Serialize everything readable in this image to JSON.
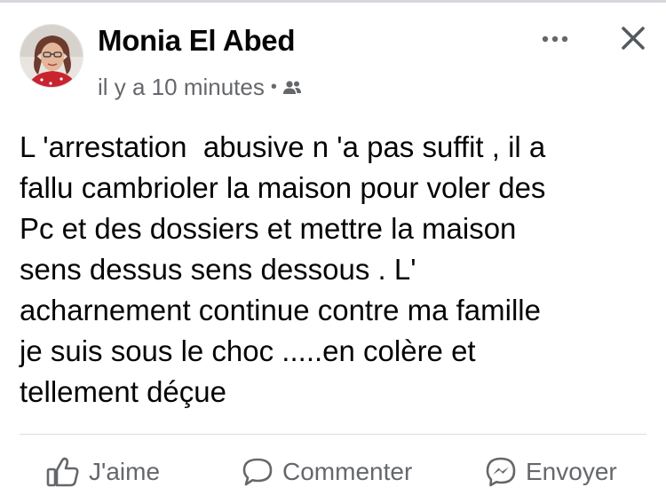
{
  "post": {
    "author": "Monia El Abed",
    "timestamp": "il y a 10 minutes",
    "separator": "•",
    "audience_icon": "friends-icon",
    "text": "L 'arrestation  abusive n 'a pas suffit , il a\nfallu cambrioler la maison pour voler des\nPc et des dossiers et mettre la maison\nsens dessus sens dessous . L'\nacharnement continue contre ma famille\nje suis sous le choc .....en colère et\ntellement déçue"
  },
  "header_actions": {
    "more_icon": "more-dots-icon",
    "close_icon": "close-icon"
  },
  "actions": [
    {
      "label": "J'aime",
      "icon": "thumbs-up-icon"
    },
    {
      "label": "Commenter",
      "icon": "comment-icon"
    },
    {
      "label": "Envoyer",
      "icon": "messenger-icon"
    }
  ],
  "colors": {
    "text": "#050505",
    "secondary_text": "#65676b",
    "divider": "#dadde1"
  }
}
